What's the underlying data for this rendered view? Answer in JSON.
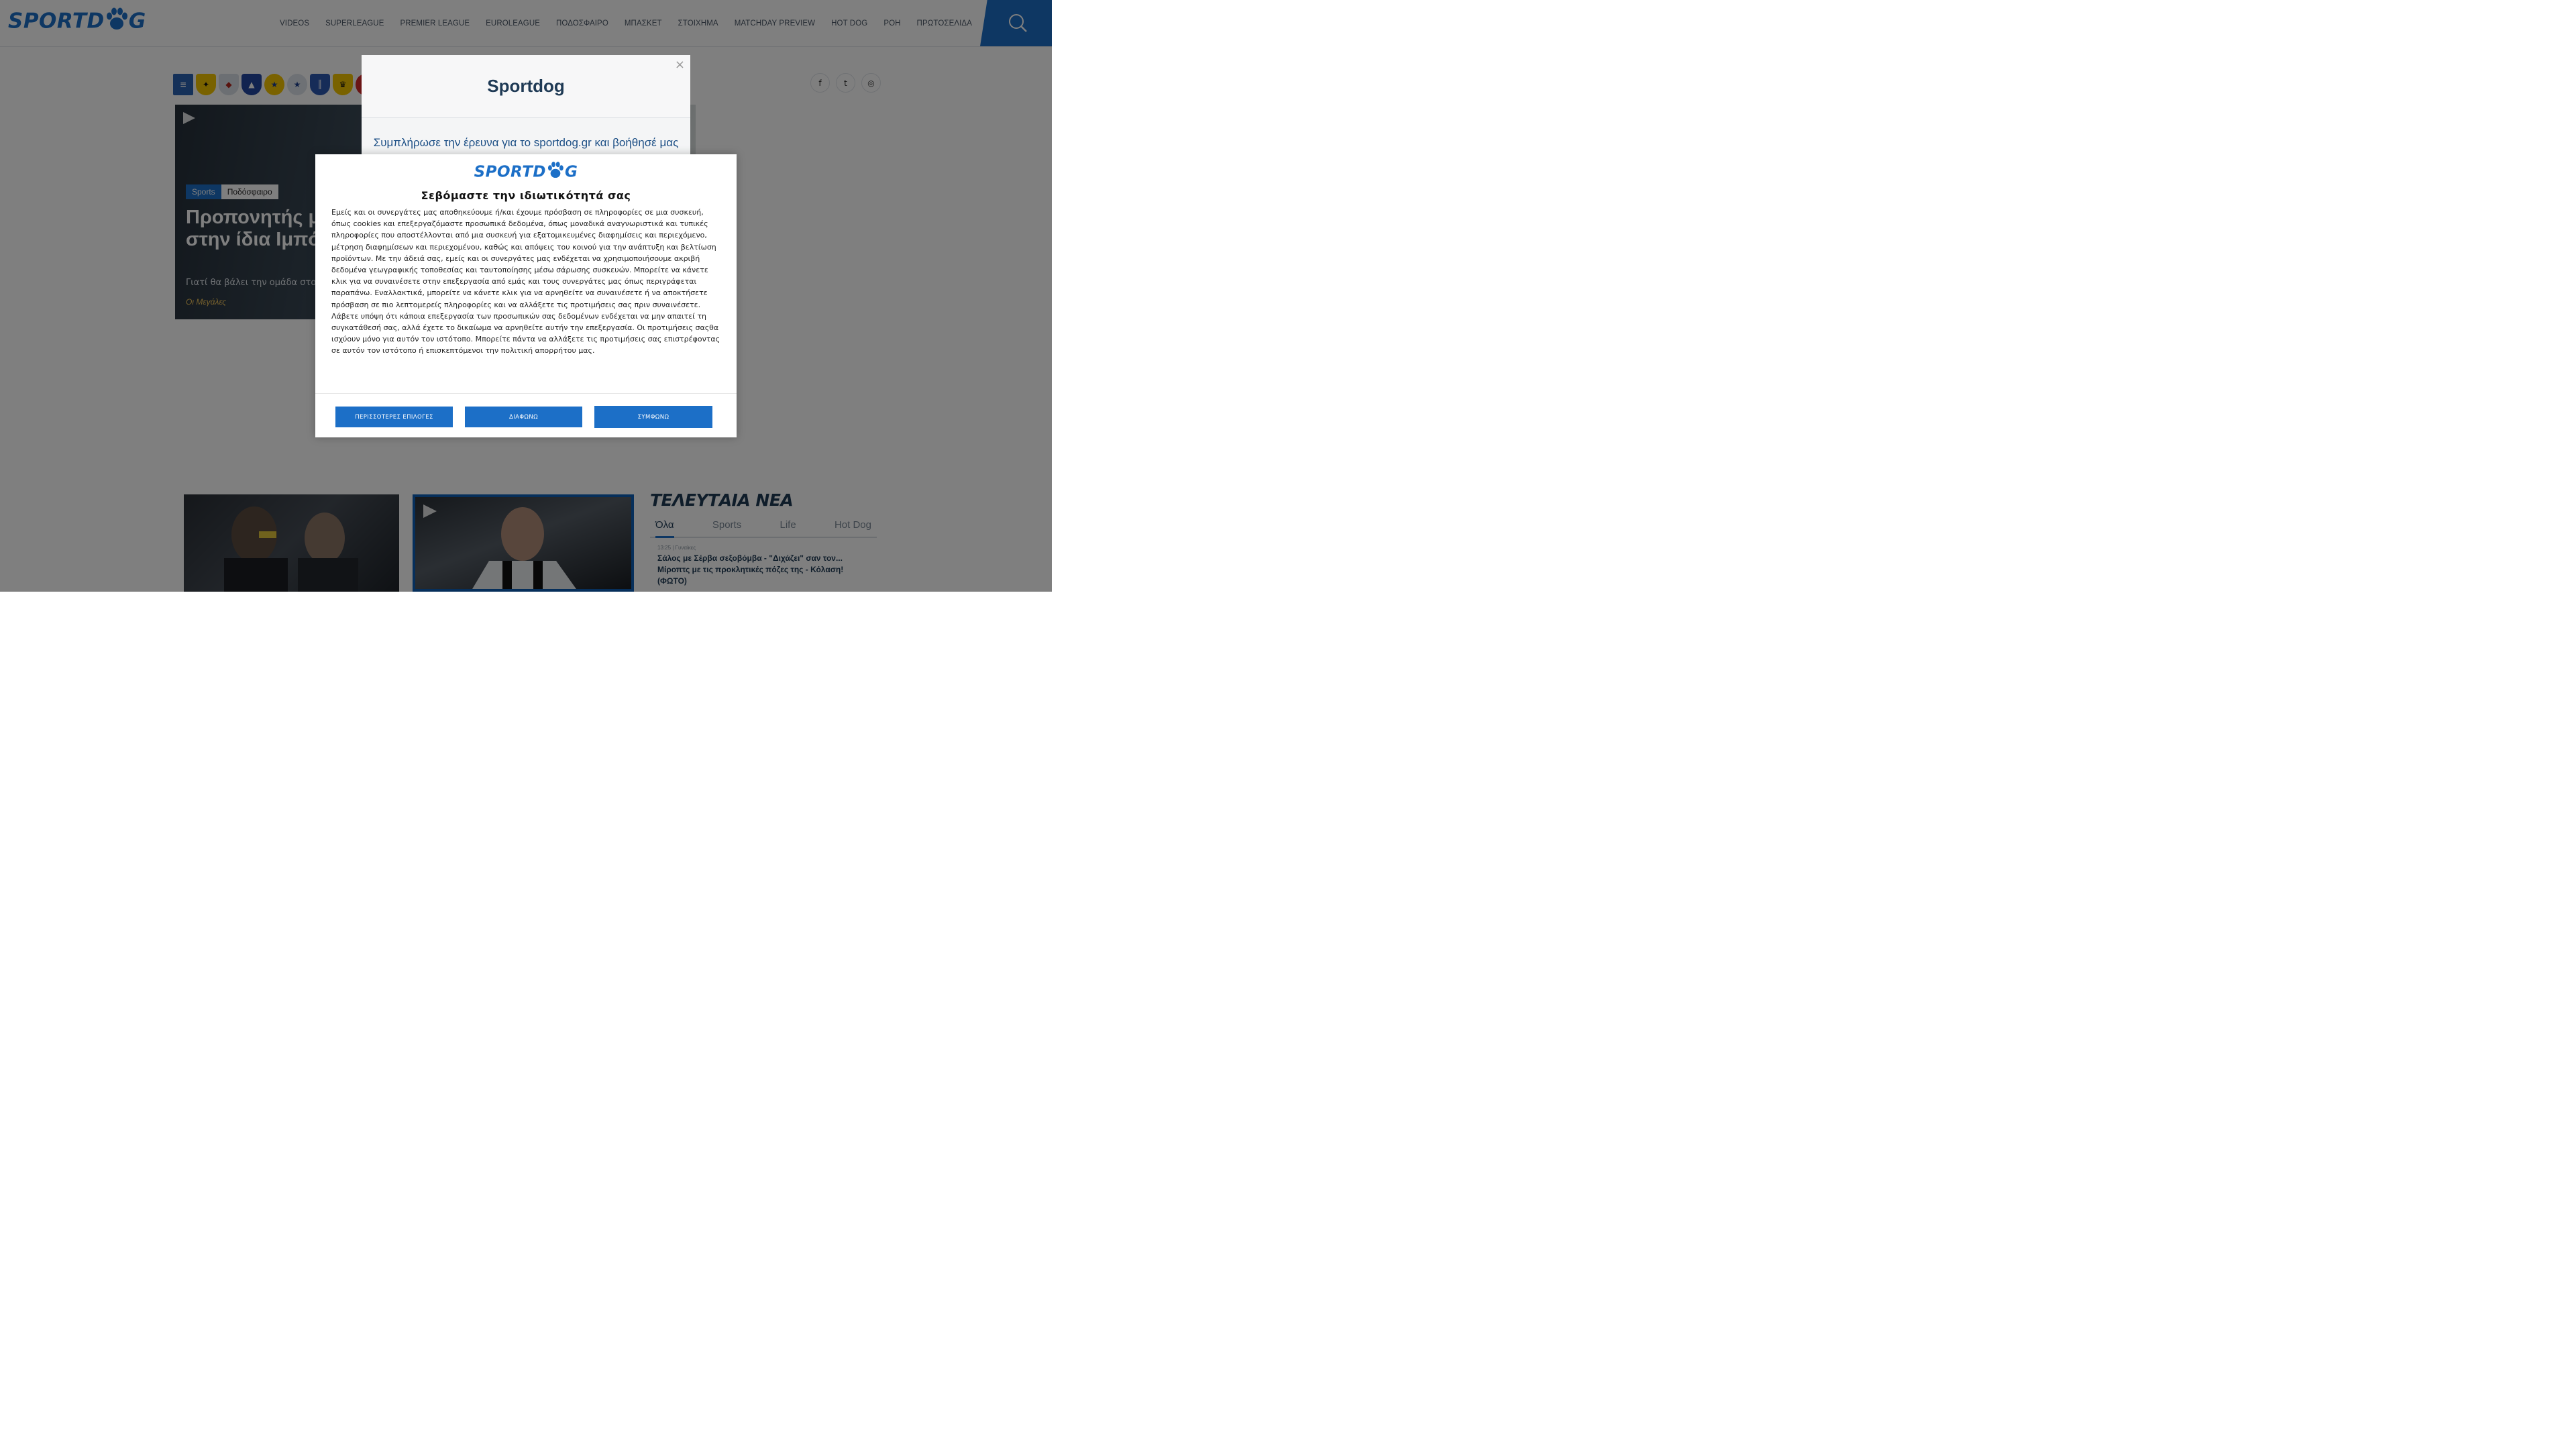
{
  "header": {
    "logo_text": "SPORTDOG",
    "nav": [
      "VIDEOS",
      "SUPERLEAGUE",
      "PREMIER LEAGUE",
      "EUROLEAGUE",
      "ΠΟΔΟΣΦΑΙΡΟ",
      "ΜΠΑΣΚΕΤ",
      "ΣΤΟΙΧΗΜΑ",
      "MATCHDAY PREVIEW",
      "HOT DOG",
      "ΡΟΗ",
      "ΠΡΩΤΟΣΕΛΙΔΑ"
    ],
    "search_icon": "search-icon"
  },
  "socials": [
    "f",
    "t",
    "◎"
  ],
  "hero": {
    "tags": [
      "Sports",
      "Ποδόσφαιρο"
    ],
    "title": "Προπονητής με... ξεκινούν στην ίδια Ιμπόρα - Έξι μετα",
    "subtitle": "Γιατί θα βάλει την ομάδα στο",
    "author": "Οι Μεγάλες"
  },
  "latest": {
    "title": "ΤΕΛΕΥΤΑΙΑ ΝΕΑ",
    "tabs": [
      "Όλα",
      "Sports",
      "Life",
      "Hot Dog"
    ],
    "items": [
      {
        "meta": "13:25 | Γυναίκες",
        "title": "Σάλος με Σέρβα σεξοβόμβα - \"Διχάζει\" σαν τον... Μίροπτς με τις προκλητικές πόζες της - Κόλαση! (ΦΩΤΟ)"
      }
    ]
  },
  "survey": {
    "title": "Sportdog",
    "text": "Συμπλήρωσε την έρευνα για το sportdog.gr και βοήθησέ μας να",
    "close": "×"
  },
  "consent": {
    "logo_text": "SPORTDOG",
    "heading": "Σεβόμαστε την ιδιωτικότητά σας",
    "body": "Εμείς και οι συνεργάτες μας αποθηκεύουμε ή/και έχουμε πρόσβαση σε πληροφορίες σε μια συσκευή, όπως cookies και επεξεργαζόμαστε προσωπικά δεδομένα, όπως μοναδικά αναγνωριστικά και τυπικές πληροφορίες που αποστέλλονται από μια συσκευή για εξατομικευμένες διαφημίσεις και περιεχόμενο, μέτρηση διαφημίσεων και περιεχομένου, καθώς και απόψεις του κοινού για την ανάπτυξη και βελτίωση προϊόντων. Με την άδειά σας, εμείς και οι συνεργάτες μας ενδέχεται να χρησιμοποιήσουμε ακριβή δεδομένα γεωγραφικής τοποθεσίας και ταυτοποίησης μέσω σάρωσης συσκευών. Μπορείτε να κάνετε κλικ για να συναινέσετε στην επεξεργασία από εμάς και τους συνεργάτες μας όπως περιγράφεται παραπάνω. Εναλλακτικά, μπορείτε να κάνετε κλικ για να αρνηθείτε να συναινέσετε ή να αποκτήσετε πρόσβαση σε πιο λεπτομερείς πληροφορίες και να αλλάξετε τις προτιμήσεις σας πριν συναινέσετε. Λάβετε υπόψη ότι κάποια επεξεργασία των προσωπικών σας δεδομένων ενδέχεται να μην απαιτεί τη συγκατάθεσή σας, αλλά έχετε το δικαίωμα να αρνηθείτε αυτήν την επεξεργασία. Οι προτιμήσεις σαςθα ισχύουν μόνο για αυτόν τον ιστότοπο. Μπορείτε πάντα να αλλάξετε τις προτιμήσεις σας επιστρέφοντας σε αυτόν τον ιστότοπο ή επισκεπτόμενοι την πολιτική απορρήτου μας.",
    "buttons": {
      "more": "ΠΕΡΙΣΣΟΤΕΡΕΣ ΕΠΙΛΟΓΕΣ",
      "disagree": "ΔΙΑΦΩΝΩ",
      "agree": "ΣΥΜΦΩΝΩ"
    }
  },
  "colors": {
    "brand_blue": "#1c6fc7",
    "navy": "#1f3a55"
  }
}
